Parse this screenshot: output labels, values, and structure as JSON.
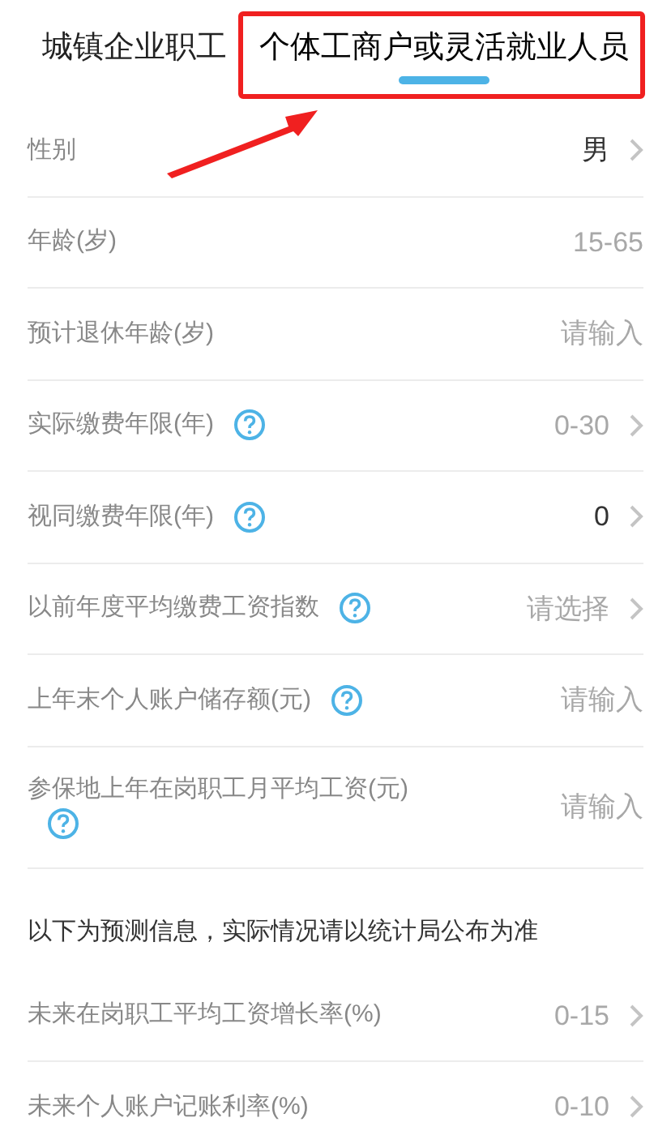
{
  "tabs": [
    {
      "label": "城镇企业职工",
      "selected": false
    },
    {
      "label": "个体工商户或灵活就业人员",
      "selected": true
    }
  ],
  "rows": [
    {
      "label": "性别",
      "kind": "select",
      "value": "男",
      "help": false
    },
    {
      "label": "年龄(岁)",
      "kind": "input",
      "placeholder": "15-65",
      "help": false
    },
    {
      "label": "预计退休年龄(岁)",
      "kind": "input",
      "placeholder": "请输入",
      "help": false
    },
    {
      "label": "实际缴费年限(年)",
      "kind": "select",
      "placeholder": "0-30",
      "help": true
    },
    {
      "label": "视同缴费年限(年)",
      "kind": "select",
      "value": "0",
      "help": true
    },
    {
      "label": "以前年度平均缴费工资指数",
      "kind": "select",
      "placeholder": "请选择",
      "help": true
    },
    {
      "label": "上年末个人账户储存额(元)",
      "kind": "input",
      "placeholder": "请输入",
      "help": true
    },
    {
      "label": "参保地上年在岗职工月平均工资(元)",
      "kind": "input",
      "placeholder": "请输入",
      "help": true
    }
  ],
  "note": "以下为预测信息，实际情况请以统计局公布为准",
  "forecast_rows": [
    {
      "label": "未来在岗职工平均工资增长率(%)",
      "kind": "select",
      "placeholder": "0-15",
      "help": false
    },
    {
      "label": "未来个人账户记账利率(%)",
      "kind": "select",
      "placeholder": "0-10",
      "help": false
    }
  ]
}
